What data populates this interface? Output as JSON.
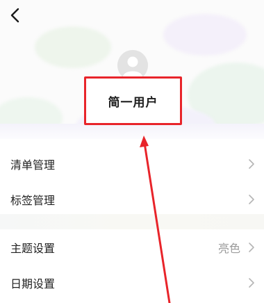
{
  "header": {
    "back_icon": "chevron-left-icon"
  },
  "profile": {
    "avatar_icon": "user-avatar-icon",
    "username": "简一用户"
  },
  "menu": {
    "group1": [
      {
        "label": "清单管理",
        "value": "",
        "icon": "chevron-right-icon"
      },
      {
        "label": "标签管理",
        "value": "",
        "icon": "chevron-right-icon"
      }
    ],
    "group2": [
      {
        "label": "主题设置",
        "value": "亮色",
        "icon": "chevron-right-icon"
      },
      {
        "label": "日期设置",
        "value": "",
        "icon": "chevron-right-icon"
      }
    ]
  },
  "colors": {
    "highlight": "#e8242a",
    "text_primary": "#222222",
    "text_secondary": "#9a9a9a"
  }
}
